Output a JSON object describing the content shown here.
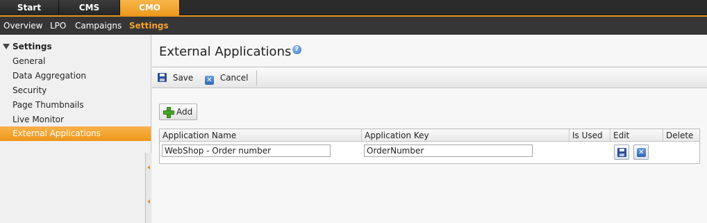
{
  "top_tabs": [
    "Start",
    "CMS",
    "CMO"
  ],
  "sub_nav": [
    "Overview",
    "LPO",
    "Campaigns",
    "Settings"
  ],
  "sidebar": {
    "header": "Settings",
    "items": [
      "General",
      "Data Aggregation",
      "Security",
      "Page Thumbnails",
      "Live Monitor",
      "External Applications"
    ]
  },
  "page": {
    "title": "External Applications",
    "help_icon": "?"
  },
  "toolbar": {
    "save_label": "Save",
    "cancel_label": "Cancel"
  },
  "add_label": "Add",
  "table": {
    "columns": [
      "Application Name",
      "Application Key",
      "Is Used",
      "Edit",
      "Delete"
    ],
    "rows": [
      {
        "name": "WebShop - Order number",
        "key": "OrderNumber",
        "is_used": ""
      }
    ]
  },
  "colors": {
    "accent": "#ee9b1e",
    "topbar": "#2b2b2b",
    "subnav": "#363636",
    "active_sidebar": "#f3a22f"
  },
  "icons": [
    "help-icon",
    "save-icon",
    "cancel-icon",
    "plus-icon"
  ]
}
